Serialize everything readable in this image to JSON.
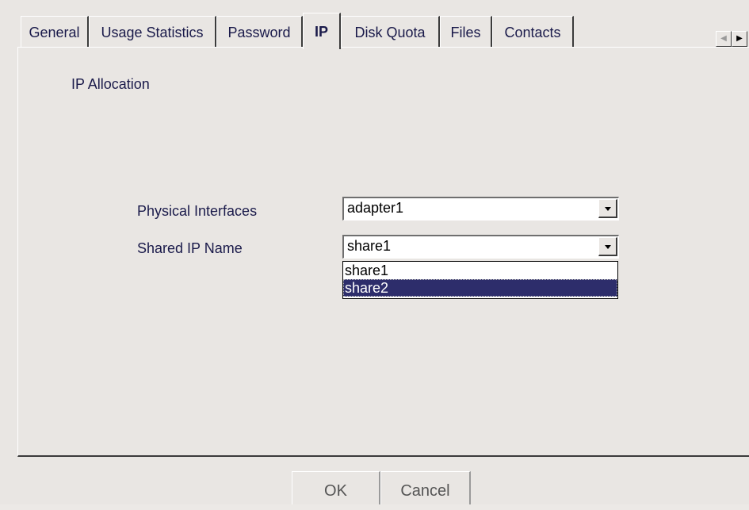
{
  "tabs": [
    {
      "label": "General"
    },
    {
      "label": "Usage Statistics"
    },
    {
      "label": "Password"
    },
    {
      "label": "IP",
      "active": true
    },
    {
      "label": "Disk Quota"
    },
    {
      "label": "Files"
    },
    {
      "label": "Contacts"
    }
  ],
  "tab_scroll": {
    "left_icon": "arrow-left-icon",
    "right_icon": "arrow-right-icon"
  },
  "panel": {
    "section_label": "IP Allocation",
    "physical_interfaces": {
      "label": "Physical Interfaces",
      "value": "adapter1"
    },
    "shared_ip_name": {
      "label": "Shared IP Name",
      "value": "share1",
      "options": [
        "share1",
        "share2"
      ],
      "highlighted_option": "share2"
    }
  },
  "buttons": {
    "ok_label": "OK",
    "cancel_label": "Cancel"
  },
  "colors": {
    "background": "#e9e6e3",
    "selection": "#2d2d6b",
    "text": "#1a1a4a"
  }
}
